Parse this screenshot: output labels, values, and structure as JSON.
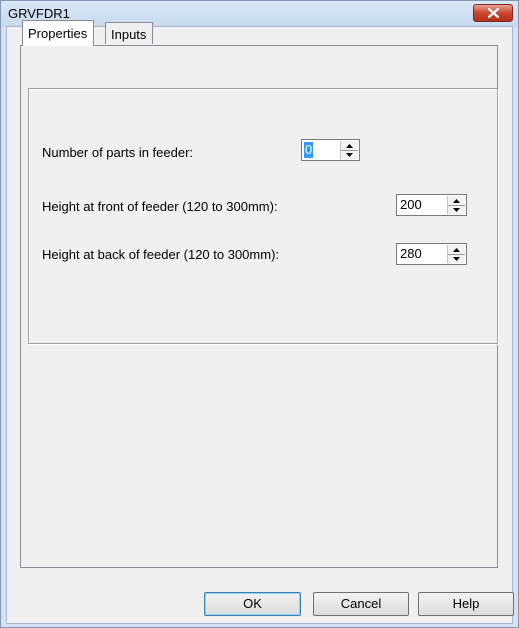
{
  "window": {
    "title": "GRVFDR1"
  },
  "tabs": [
    {
      "label": "Properties",
      "selected": true
    },
    {
      "label": "Inputs",
      "selected": false
    }
  ],
  "fields": [
    {
      "label": "Number of parts in feeder:",
      "value": "0"
    },
    {
      "label": "Height at front of feeder (120 to 300mm):",
      "value": "200"
    },
    {
      "label": "Height at back of feeder  (120 to 300mm):",
      "value": "280"
    }
  ],
  "buttons": {
    "ok": "OK",
    "cancel": "Cancel",
    "help": "Help"
  },
  "icons": {
    "close": "close-icon",
    "spin_up": "arrow-up-icon",
    "spin_down": "arrow-down-icon"
  },
  "colors": {
    "title_bg": "#c6d9ef",
    "close_bg": "#c9452e",
    "selection": "#3399ff"
  }
}
